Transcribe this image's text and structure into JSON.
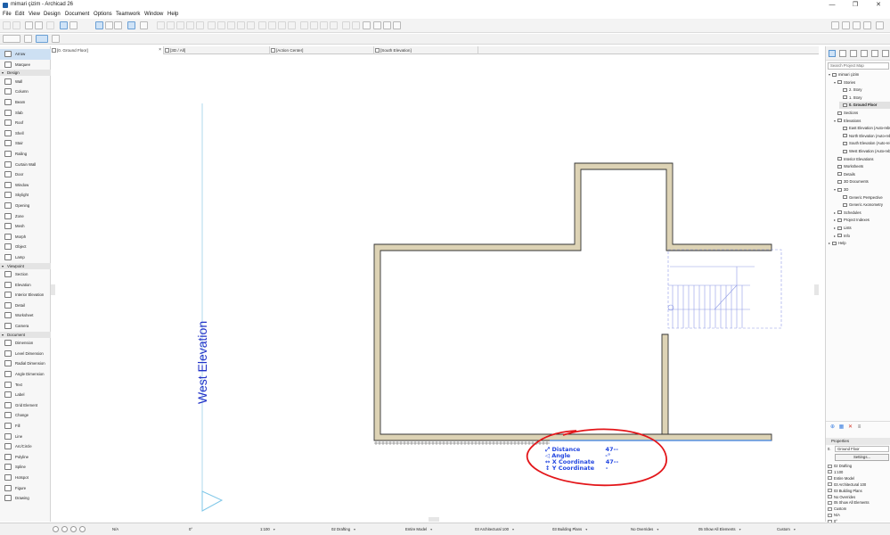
{
  "window": {
    "title": "mimari çizim - Archicad 26",
    "minimize": "—",
    "maximize": "❐",
    "close": "✕"
  },
  "menu": [
    "File",
    "Edit",
    "View",
    "Design",
    "Document",
    "Options",
    "Teamwork",
    "Window",
    "Help"
  ],
  "tabs": [
    {
      "label": "[0. Ground Floor]",
      "close": "×"
    },
    {
      "label": "[3D / All]"
    },
    {
      "label": "[Action Center]"
    },
    {
      "label": "[South Elevation]"
    }
  ],
  "toolbox": {
    "top_tools": [
      {
        "label": "Arrow",
        "active": true
      },
      {
        "label": "Marquee"
      }
    ],
    "groups": [
      {
        "name": "Design",
        "tools": [
          "Wall",
          "Column",
          "Beam",
          "Slab",
          "Roof",
          "Shell",
          "Stair",
          "Railing",
          "Curtain Wall",
          "Door",
          "Window",
          "Skylight",
          "Opening",
          "Zone",
          "Mesh",
          "Morph",
          "Object",
          "Lamp"
        ]
      },
      {
        "name": "Viewpoint",
        "tools": [
          "Section",
          "Elevation",
          "Interior Elevation",
          "Detail",
          "Worksheet",
          "Camera"
        ]
      },
      {
        "name": "Document",
        "tools": [
          "Dimension",
          "Level Dimension",
          "Radial Dimension",
          "Angle Dimension",
          "Text",
          "Label",
          "Grid Element",
          "Change",
          "Fill",
          "Line",
          "Arc/Circle",
          "Polyline",
          "Spline",
          "Hotspot",
          "Figure",
          "Drawing"
        ]
      }
    ]
  },
  "canvas": {
    "west_elevation_label": "West Elevation",
    "tracker": [
      {
        "label": "Distance",
        "value": "47--"
      },
      {
        "label": "Angle",
        "value": "-°"
      },
      {
        "label": "X Coordinate",
        "value": "47--"
      },
      {
        "label": "Y Coordinate",
        "value": "-"
      }
    ],
    "colors": {
      "wall_fill": "#ddd3b5",
      "wall_stroke": "#333333",
      "stair_lines": "#8f9be6",
      "annotation_circle": "#e3161a",
      "elevation_marker": "#7fc7e8"
    }
  },
  "navigator": {
    "search_placeholder": "Search Project Map",
    "tree": [
      {
        "label": "mimari çizim",
        "level": 0,
        "exp": "▾"
      },
      {
        "label": "Stories",
        "level": 1,
        "exp": "▾"
      },
      {
        "label": "2. Story",
        "level": 2
      },
      {
        "label": "1. Story",
        "level": 2
      },
      {
        "label": "0. Ground Floor",
        "level": 2,
        "selected": true
      },
      {
        "label": "Sections",
        "level": 1
      },
      {
        "label": "Elevations",
        "level": 1,
        "exp": "▾"
      },
      {
        "label": "East Elevation (Auto-rebuild Model)",
        "level": 2
      },
      {
        "label": "North Elevation (Auto-rebuild Model)",
        "level": 2
      },
      {
        "label": "South Elevation (Auto-rebuild Model)",
        "level": 2
      },
      {
        "label": "West Elevation (Auto-rebuild Model)",
        "level": 2
      },
      {
        "label": "Interior Elevations",
        "level": 1
      },
      {
        "label": "Worksheets",
        "level": 1
      },
      {
        "label": "Details",
        "level": 1
      },
      {
        "label": "3D Documents",
        "level": 1
      },
      {
        "label": "3D",
        "level": 1,
        "exp": "▾"
      },
      {
        "label": "Generic Perspective",
        "level": 2
      },
      {
        "label": "Generic Axonometry",
        "level": 2
      },
      {
        "label": "Schedules",
        "level": 1,
        "exp": "▸"
      },
      {
        "label": "Project Indexes",
        "level": 1,
        "exp": "▸"
      },
      {
        "label": "Lists",
        "level": 1,
        "exp": "▸"
      },
      {
        "label": "Info",
        "level": 1,
        "exp": "▸"
      },
      {
        "label": "Help",
        "level": 0,
        "exp": "▸"
      }
    ],
    "properties": {
      "header": "Properties",
      "story_number": "0.",
      "story_name": "Ground Floor",
      "settings_button": "Settings..."
    },
    "layers": [
      "02 Drafting",
      "1:100",
      "Entire Model",
      "03 Architectural 100",
      "03 Building Plans",
      "No Overrides",
      "05 Show All Elements",
      "Custom",
      "N/A",
      "0°"
    ]
  },
  "statusbar": {
    "zoom_value": "N/A",
    "angle_value": "0°",
    "scale": "1:100",
    "layer_combo": "02 Drafting",
    "model_view": "Entire Model",
    "pen_set": "03 Architectural 100",
    "view_map": "03 Building Plans",
    "overrides": "No Overrides",
    "renovation": "05 Show All Elements",
    "dimensions": "Custom"
  }
}
